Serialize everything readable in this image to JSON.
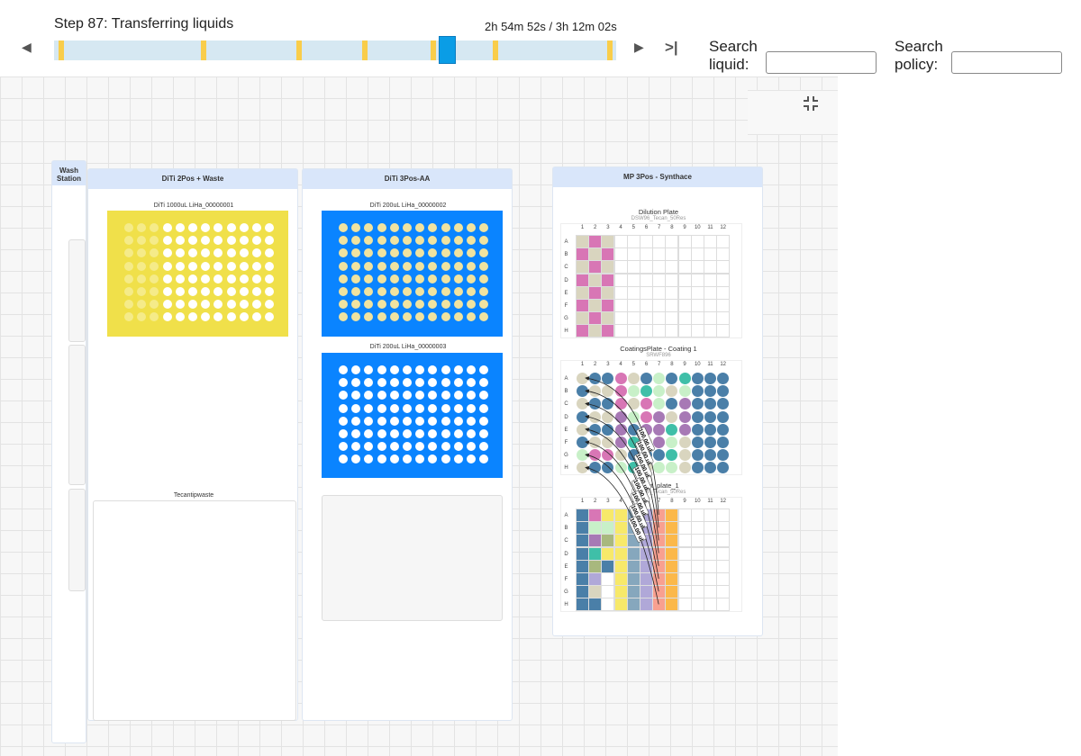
{
  "header": {
    "step_title": "Step 87: Transferring liquids",
    "elapsed": "2h 54m 52s / 3h 12m 02s",
    "timeline": {
      "progress_fraction": 0.682,
      "markers_fraction": [
        0.008,
        0.263,
        0.435,
        0.553,
        0.677,
        0.788,
        0.993
      ],
      "marker_color": "#f9cd4a",
      "handle_color": "#0a9de6"
    },
    "prev_icon": "triangle-left-icon",
    "next_icon": "triangle-right-icon",
    "skip_end_label": ">|",
    "search_liquid_label": "Search liquid:",
    "search_liquid_value": "",
    "search_policy_label": "Search policy:",
    "search_policy_value": "",
    "collapse_icon": "compress-icon"
  },
  "deck": {
    "wash_station": {
      "title": "Wash Station"
    },
    "diti_2pos": {
      "title": "DiTi 2Pos + Waste",
      "rack_label": "DiTi 1000uL LiHa_00000001",
      "rack_color": "#f0e04a",
      "used_columns": 3,
      "waste_label": "Tecantipwaste"
    },
    "diti_3pos": {
      "title": "DiTi 3Pos-AA",
      "rack1_label": "DiTi 200uL LiHa_00000002",
      "rack2_label": "DiTi 200uL LiHa_00000003",
      "rack_color": "#0a84ff",
      "rack1_tip_color": "#f0e3a0",
      "rack2_tip_color": "#ffffff"
    },
    "mp_3pos": {
      "title": "MP 3Pos - Synthace",
      "columns": [
        "1",
        "2",
        "3",
        "4",
        "5",
        "6",
        "7",
        "8",
        "9",
        "10",
        "11",
        "12"
      ],
      "rows": [
        "A",
        "B",
        "C",
        "D",
        "E",
        "F",
        "G",
        "H"
      ],
      "palette": {
        "w": "#ffffff",
        "k": "#d9d5bf",
        "u": "#4a7fa8",
        "p": "#d876b5",
        "g": "#c8f0c8",
        "t": "#3fbfa8",
        "v": "#a779b5",
        "o": "#a8b87e",
        "l": "#b0a8d8",
        "y": "#f7e96a",
        "s": "#86a7bd",
        "r": "#f8a090",
        "n": "#fbb84a"
      },
      "plates": [
        {
          "title": "Dilution Plate",
          "subtitle": "DSW96_Tecan_50Res",
          "shape": "square",
          "wells": [
            "kpkwwwwwwwww",
            "pkpwwwwwwwww",
            "kpkwwwwwwwww",
            "pkpwwwwwwwww",
            "kpkwwwwwwwww",
            "pkpwwwwwwwww",
            "kpkwwwwwwwww",
            "pkpwwwwwwwww"
          ]
        },
        {
          "title": "CoatingsPlate - Coating 1",
          "subtitle": "SRWF896",
          "shape": "circle",
          "wells": [
            "kuupkugutuuu",
            "ukkpgtgkguuu",
            "kuupkpguvuuu",
            "ukkvgpvkvuuu",
            "kuuvuvvtvuuu",
            "ukkvtkvgkuuu",
            "gppkuuutkuuu",
            "kuugtkggkuuu"
          ]
        },
        {
          "title": "Input_plate_1",
          "subtitle": "DSW96_Tecan_50Res",
          "shape": "square",
          "wells": [
            "upyyslrnwwww",
            "uggyslrnwwww",
            "uvoyslrnwwww",
            "utyyslrnwwww",
            "uouyslrnwwww",
            "ulwyslrnwwww",
            "ukwyslrnwwww",
            "uuwyslrnwwww"
          ]
        }
      ],
      "transfers": [
        "100.00 ul",
        "100.00 ul",
        "100.00 ul",
        "100.00 ul",
        "100.00 ul",
        "100.00 ul",
        "100.00 ul",
        "100.00 ul"
      ]
    }
  }
}
